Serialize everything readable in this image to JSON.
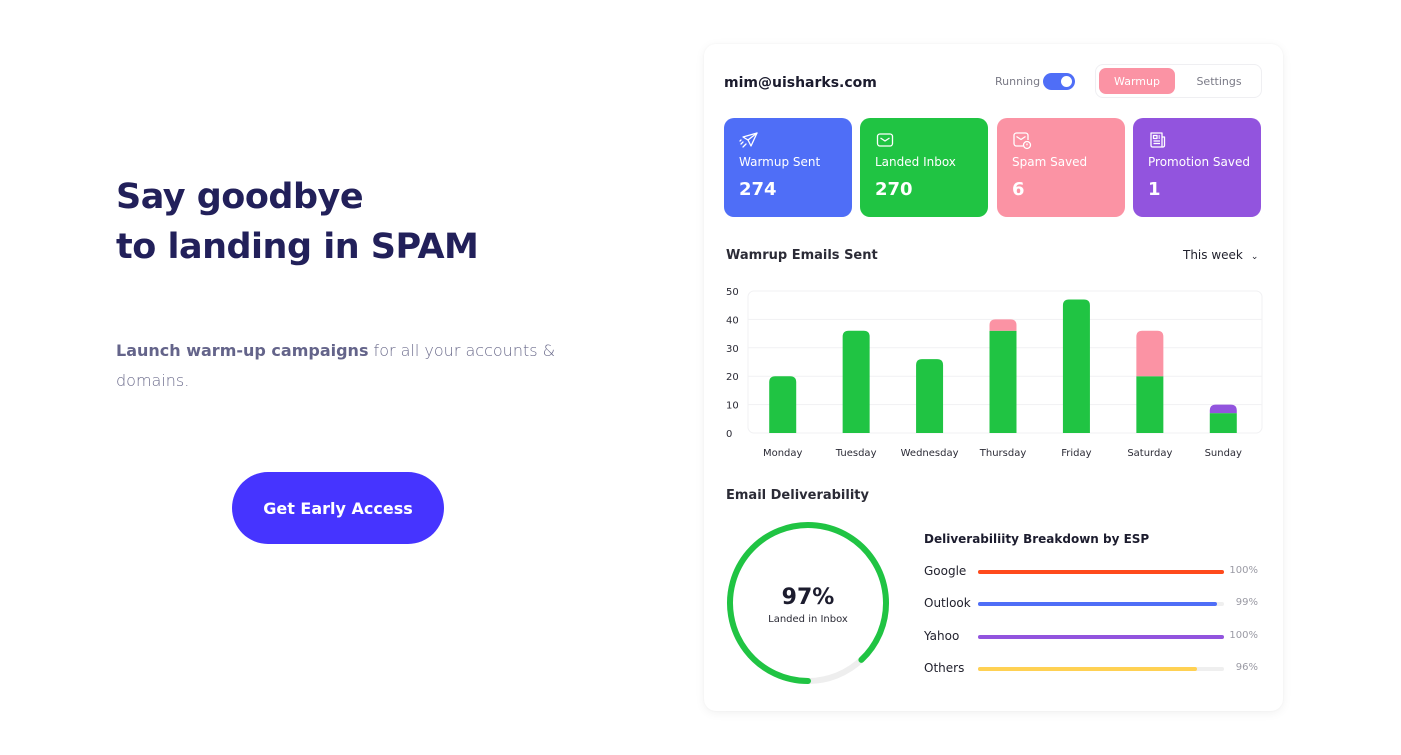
{
  "hero": {
    "title_line1": "Say goodbye",
    "title_line2": "to landing in SPAM",
    "subtitle_bold": "Launch warm-up campaigns",
    "subtitle_rest": " for all your accounts & domains.",
    "cta_label": "Get Early Access",
    "cta_color": "#4634ff"
  },
  "dashboard": {
    "account_email": "mim@uisharks.com",
    "status_label": "Running",
    "status_on": true,
    "tabs": [
      {
        "label": "Warmup",
        "active": true
      },
      {
        "label": "Settings",
        "active": false
      }
    ],
    "stats": [
      {
        "label": "Warmup Sent",
        "value": "274",
        "icon": "paper-plane-icon",
        "color": "#4f6ef7"
      },
      {
        "label": "Landed Inbox",
        "value": "270",
        "icon": "envelope-icon",
        "color": "#20c443"
      },
      {
        "label": "Spam Saved",
        "value": "6",
        "icon": "envelope-alert-icon",
        "color": "#fb93a4"
      },
      {
        "label": "Promotion Saved",
        "value": "1",
        "icon": "newspaper-icon",
        "color": "#9254de"
      }
    ],
    "chart_title": "Wamrup Emails Sent",
    "period_select": "This week",
    "deliverability_title": "Email Deliverability",
    "gauge": {
      "value_label": "97%",
      "caption": "Landed in Inbox",
      "value": 0.97,
      "color": "#20c443",
      "track_color": "#eeeeee"
    },
    "esp_title": "Deliverabiliity Breakdown by ESP",
    "esp": [
      {
        "name": "Google",
        "percent_label": "100%",
        "fill": 1.0,
        "color": "#ff4a1c"
      },
      {
        "name": "Outlook",
        "percent_label": "99%",
        "fill": 0.97,
        "color": "#4f6ef7"
      },
      {
        "name": "Yahoo",
        "percent_label": "100%",
        "fill": 1.0,
        "color": "#9254de"
      },
      {
        "name": "Others",
        "percent_label": "96%",
        "fill": 0.89,
        "color": "#ffd153"
      }
    ]
  },
  "chart_data": {
    "type": "bar",
    "stacked": true,
    "title": "Wamrup Emails Sent",
    "xlabel": "",
    "ylabel": "",
    "categories": [
      "Monday",
      "Tuesday",
      "Wednesday",
      "Thursday",
      "Friday",
      "Saturday",
      "Sunday"
    ],
    "series": [
      {
        "name": "Landed Inbox",
        "color": "#20c443",
        "values": [
          20,
          36,
          26,
          36,
          47,
          20,
          7
        ]
      },
      {
        "name": "Spam Saved",
        "color": "#fb93a4",
        "values": [
          0,
          0,
          0,
          4,
          0,
          16,
          0
        ]
      },
      {
        "name": "Promotion Saved",
        "color": "#9254de",
        "values": [
          0,
          0,
          0,
          0,
          0,
          0,
          3
        ]
      }
    ],
    "yticks": [
      0,
      10,
      20,
      30,
      40,
      50
    ],
    "ylim": [
      0,
      50
    ],
    "grid": true,
    "legend": "none"
  }
}
